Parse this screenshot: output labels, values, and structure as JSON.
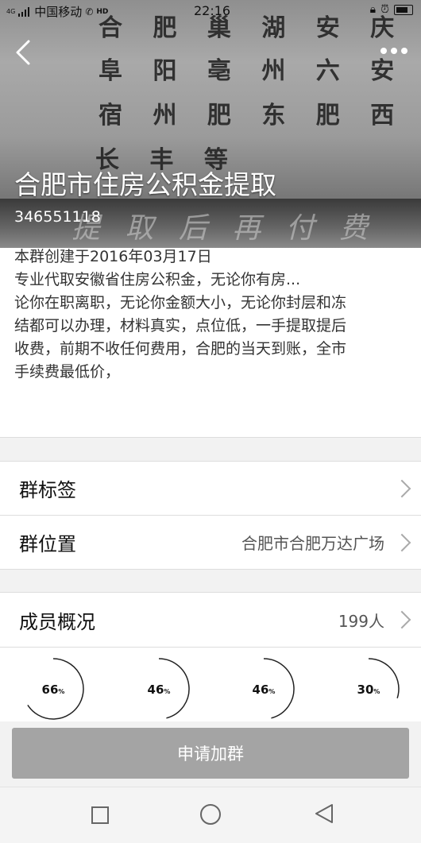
{
  "status_bar": {
    "network": "4G",
    "carrier": "中国移动",
    "hd": "HD",
    "time": "22:16"
  },
  "banner": {
    "calligraphy_rows": [
      "合 肥  巢 湖  安 庆",
      "阜 阳  亳 州  六 安",
      "宿 州  肥 东  肥 西",
      "长 丰 等"
    ],
    "strip_text": "提 取 后   再 付 费"
  },
  "header": {
    "group_name": "合肥市住房公积金提取",
    "group_id": "346551118"
  },
  "description": {
    "created": "本群创建于2016年03月17日",
    "lines": [
      "专业代取安徽省住房公积金，无论你有房...",
      "论你在职离职，无论你金额大小，无论你封层和冻",
      "结都可以办理，材料真实，点位低，一手提取提后",
      "收费，前期不收任何费用，合肥的当天到账，全市",
      "手续费最低价，"
    ]
  },
  "rows": {
    "tags_label": "群标签",
    "location_label": "群位置",
    "location_value": "合肥市合肥万达广场",
    "members_label": "成员概况",
    "members_value": "199人"
  },
  "member_stats": [
    {
      "value": "66",
      "unit": "%",
      "fraction": 0.66
    },
    {
      "value": "46",
      "unit": "%",
      "fraction": 0.46
    },
    {
      "value": "46",
      "unit": "%",
      "fraction": 0.46
    },
    {
      "value": "30",
      "unit": "%",
      "fraction": 0.3
    }
  ],
  "join_button": "申请加群",
  "colors": {
    "button": "#a4a4a4",
    "text": "#222222"
  }
}
